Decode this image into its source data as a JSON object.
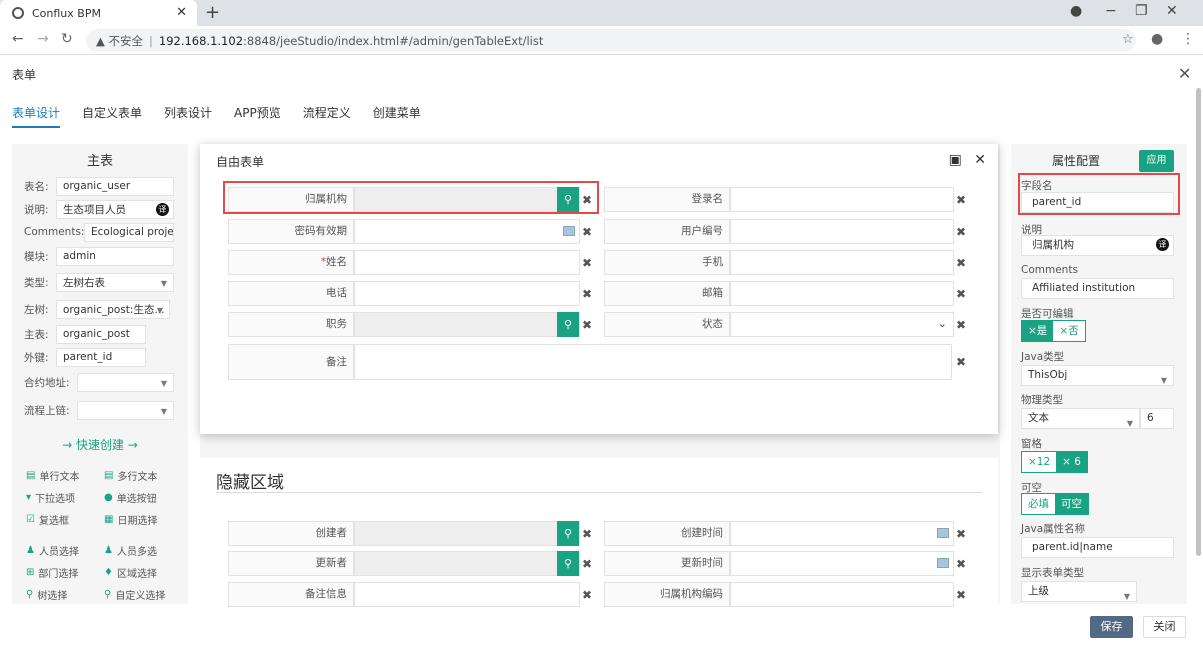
{
  "browser": {
    "tab_title": "Conflux BPM",
    "tab_close": "✕",
    "new_tab": "+",
    "url_warning": "▲ 不安全",
    "url_sep": "|",
    "url_host": "192.168.1.102",
    "url_path": ":8848/jeeStudio/index.html#/admin/genTableExt/list"
  },
  "modal": {
    "title": "表单",
    "close": "✕"
  },
  "tabs": [
    "表单设计",
    "自定义表单",
    "列表设计",
    "APP预览",
    "流程定义",
    "创建菜单"
  ],
  "left": {
    "title": "主表",
    "fields": [
      {
        "label": "表名:",
        "value": "organic_user"
      },
      {
        "label": "说明:",
        "value": "生态项目人员",
        "badge": "译"
      },
      {
        "label": "Comments:",
        "value": "Ecological project p"
      },
      {
        "label": "模块:",
        "value": "admin"
      },
      {
        "label": "类型:",
        "value": "左树右表"
      },
      {
        "label": "左树:",
        "value": "organic_post:生态..."
      },
      {
        "label": "主表:",
        "value": "organic_post"
      },
      {
        "label": "外键:",
        "value": "parent_id"
      },
      {
        "label": "合约地址:",
        "value": ""
      },
      {
        "label": "流程上链:",
        "value": ""
      }
    ],
    "quick_create": "→ 快速创建 →",
    "components": [
      "单行文本",
      "多行文本",
      "下拉选项",
      "单选按钮",
      "复选框",
      "日期选择",
      "人员选择",
      "人员多选",
      "部门选择",
      "区域选择",
      "树选择",
      "自定义选择"
    ]
  },
  "freeform": {
    "title": "自由表单",
    "rows": [
      {
        "left": "归属机构",
        "right": "登录名"
      },
      {
        "left": "密码有效期",
        "right": "用户编号"
      },
      {
        "left": "姓名",
        "required": "*",
        "right": "手机"
      },
      {
        "left": "电话",
        "right": "邮箱"
      },
      {
        "left": "职务",
        "right": "状态"
      },
      {
        "left": "备注"
      }
    ]
  },
  "hidden": {
    "title": "隐藏区域",
    "rows": [
      {
        "left": "创建者",
        "right": "创建时间"
      },
      {
        "left": "更新者",
        "right": "更新时间"
      },
      {
        "left": "备注信息",
        "right": "归属机构编码"
      }
    ]
  },
  "right": {
    "title": "属性配置",
    "apply": "应用",
    "field_name_label": "字段名",
    "field_name": "parent_id",
    "desc_label": "说明",
    "desc": "归属机构",
    "desc_badge": "译",
    "comments_label": "Comments",
    "comments": "Affiliated institution",
    "editable_label": "是否可编辑",
    "editable_yes": "×是",
    "editable_no": "×否",
    "java_type_label": "Java类型",
    "java_type": "ThisObj",
    "phys_type_label": "物理类型",
    "phys_type": "文本",
    "phys_len": "6",
    "grid_label": "窗格",
    "grid_12": "×12",
    "grid_6": "× 6",
    "nullable_label": "可空",
    "required": "必填",
    "nullable": "可空",
    "java_attr_label": "Java属性名称",
    "java_attr": "parent.id|name",
    "show_type_label": "显示表单类型",
    "show_type": "上级"
  },
  "footer": {
    "save": "保存",
    "close": "关闭"
  }
}
